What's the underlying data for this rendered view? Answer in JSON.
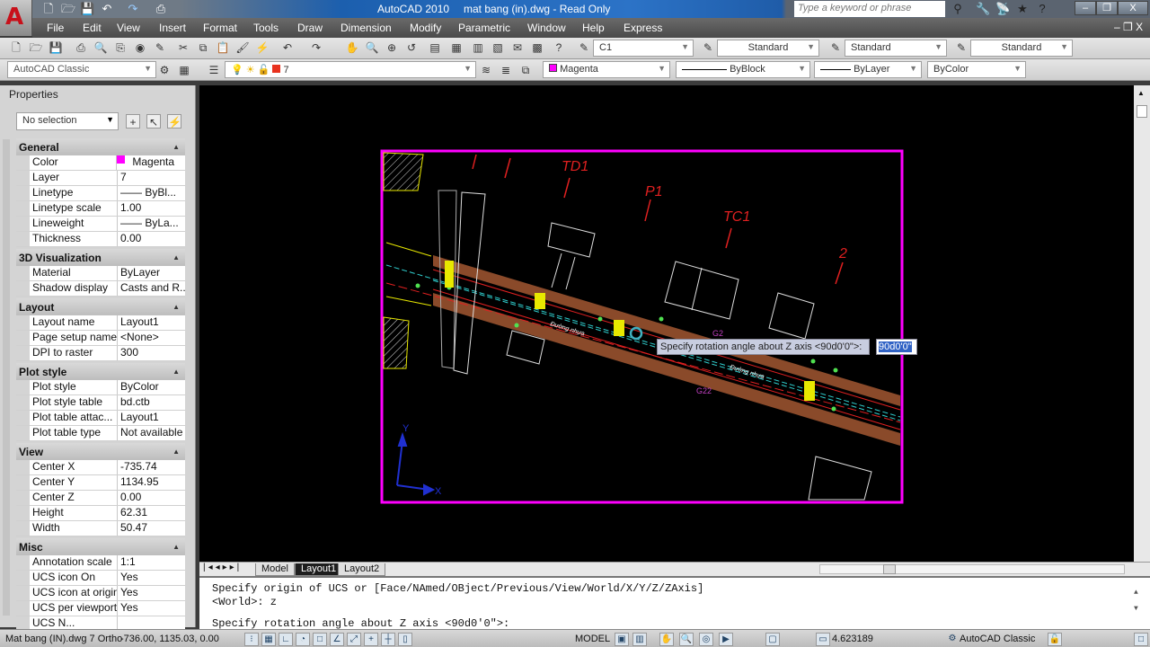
{
  "titlebar": {
    "app": "AutoCAD 2010",
    "file": "mat bang (in).dwg - Read Only",
    "search_placeholder": "Type a keyword or phrase",
    "app_logo": "A"
  },
  "menu": [
    "File",
    "Edit",
    "View",
    "Insert",
    "Format",
    "Tools",
    "Draw",
    "Dimension",
    "Modify",
    "Parametric",
    "Window",
    "Help",
    "Express"
  ],
  "toolbar": {
    "text_style": "C1",
    "dim_style": "Standard",
    "table_style": "Standard",
    "mleader_style": "Standard",
    "workspace": "AutoCAD Classic",
    "layer": "7",
    "color": "Magenta",
    "linetype": "ByBlock",
    "lineweight": "ByLayer",
    "plotstyle": "ByColor",
    "colors": {
      "magenta": "#ff00ff",
      "layer_swatch": "#e8321e"
    }
  },
  "properties": {
    "title": "Properties",
    "selection": "No selection",
    "sections": [
      {
        "name": "General",
        "rows": [
          [
            "Color",
            "Magenta"
          ],
          [
            "Layer",
            "7"
          ],
          [
            "Linetype",
            "—— ByBl..."
          ],
          [
            "Linetype scale",
            "1.00"
          ],
          [
            "Lineweight",
            "—— ByLa..."
          ],
          [
            "Thickness",
            "0.00"
          ]
        ]
      },
      {
        "name": "3D Visualization",
        "rows": [
          [
            "Material",
            "ByLayer"
          ],
          [
            "Shadow display",
            "Casts and R..."
          ]
        ]
      },
      {
        "name": "Layout",
        "rows": [
          [
            "Layout name",
            "Layout1"
          ],
          [
            "Page setup name",
            "<None>"
          ],
          [
            "DPI to raster",
            "300"
          ]
        ]
      },
      {
        "name": "Plot style",
        "rows": [
          [
            "Plot style",
            "ByColor"
          ],
          [
            "Plot style table",
            "bd.ctb"
          ],
          [
            "Plot table attac...",
            "Layout1"
          ],
          [
            "Plot table type",
            "Not available"
          ]
        ]
      },
      {
        "name": "View",
        "rows": [
          [
            "Center X",
            "-735.74"
          ],
          [
            "Center Y",
            "1134.95"
          ],
          [
            "Center Z",
            "0.00"
          ],
          [
            "Height",
            "62.31"
          ],
          [
            "Width",
            "50.47"
          ]
        ]
      },
      {
        "name": "Misc",
        "rows": [
          [
            "Annotation scale",
            "1:1"
          ],
          [
            "UCS icon On",
            "Yes"
          ],
          [
            "UCS icon at origin",
            "Yes"
          ],
          [
            "UCS per viewport",
            "Yes"
          ],
          [
            "UCS N...",
            ""
          ]
        ]
      }
    ]
  },
  "drawing": {
    "labels": {
      "td1": "TD1",
      "p1": "P1",
      "tc1": "TC1",
      "n2": "2",
      "ucs_x": "X",
      "ucs_y": "Y",
      "g2": "G2",
      "g22": "G22",
      "road1": "Đường nhựa",
      "road2": "Đường nhựa"
    },
    "tooltip": "Specify rotation angle about Z axis <90d0'0\">:",
    "input_value": "90d0'0\""
  },
  "tabs": [
    "Model",
    "Layout1",
    "Layout2"
  ],
  "active_tab": "Layout1",
  "command": {
    "line1": "Specify origin of UCS or [Face/NAmed/OBject/Previous/View/World/X/Y/Z/ZAxis]",
    "line2": "<World>: z",
    "line3": "Specify rotation angle about Z axis <90d0'0\">:"
  },
  "status": {
    "file_info": "Mat bang (IN).dwg 7 Ortho",
    "coords": "-736.00, 1135.03, 0.00",
    "model": "MODEL",
    "scale": "4.623189",
    "workspace": "AutoCAD Classic"
  }
}
